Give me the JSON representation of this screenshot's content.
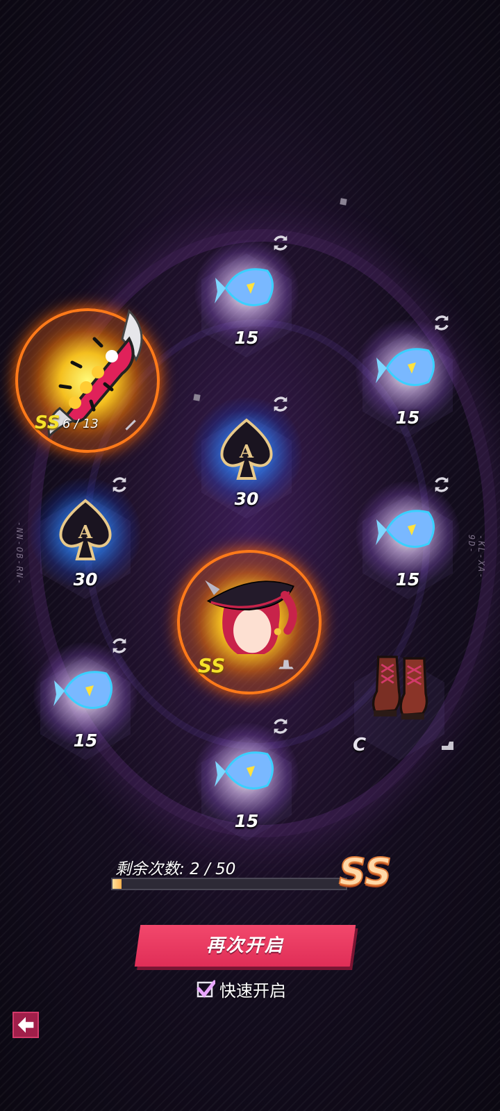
{
  "side_codes": {
    "left": "-NN-OB-RN-",
    "right": "-KL-XA-9D-"
  },
  "featured_items": [
    {
      "name": "spiked-boomerang-weapon",
      "grade": "SS",
      "count": "6 / 13"
    },
    {
      "name": "pirate-captain-hat-head",
      "grade": "SS"
    }
  ],
  "reward_cells": [
    {
      "item": "fish-token-icon",
      "quantity": "15",
      "glow": "white"
    },
    {
      "item": "fish-token-icon",
      "quantity": "15",
      "glow": "white"
    },
    {
      "item": "spade-ace-card-icon",
      "quantity": "30",
      "glow": "blue"
    },
    {
      "item": "spade-ace-card-icon",
      "quantity": "30",
      "glow": "blue"
    },
    {
      "item": "fish-token-icon",
      "quantity": "15",
      "glow": "white"
    },
    {
      "item": "fish-token-icon",
      "quantity": "15",
      "glow": "white"
    },
    {
      "item": "fish-token-icon",
      "quantity": "15",
      "glow": "white"
    },
    {
      "item": "brown-laced-boots-icon",
      "grade": "C",
      "glow": "none"
    }
  ],
  "progress": {
    "label": "剩余次数: 2 / 50",
    "fraction": 0.04,
    "target_grade": "SS"
  },
  "buttons": {
    "reopen": "再次开启",
    "fast_open": "快速开启",
    "fast_open_checked": true
  },
  "colors": {
    "accent_pink": "#e83a60",
    "orange_glow": "#ff7a1a",
    "ss_yellow": "#f5e12a"
  }
}
